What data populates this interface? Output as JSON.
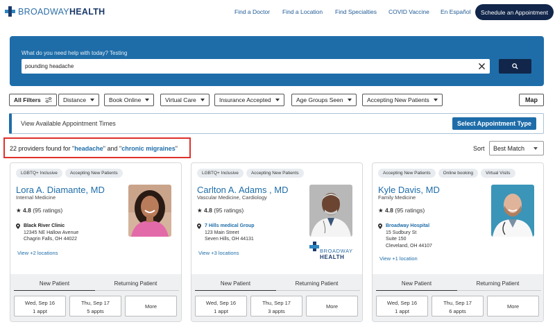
{
  "header": {
    "logo_light": "BROADWAY",
    "logo_bold": "HEALTH",
    "nav": [
      "Find a Doctor",
      "Find a Location",
      "Find Specialties",
      "COVID Vaccine",
      "En Español"
    ],
    "cta": "Schedule an Appointment"
  },
  "search": {
    "label": "What do you need help with today? Testing",
    "value": "pounding headache"
  },
  "filters": {
    "all": "All Filters",
    "items": [
      "Distance",
      "Book Online",
      "Virtual Care",
      "Insurance Accepted",
      "Age Groups Seen",
      "Accepting New Patients"
    ],
    "map": "Map"
  },
  "appointment_bar": {
    "text": "View Available Appointment Times",
    "button": "Select Appointment Type"
  },
  "results": {
    "prefix": "22 providers found for \"",
    "kw1": "headache",
    "mid": "\" and \"",
    "kw2": "chronic migraines",
    "suffix": "\""
  },
  "sort": {
    "label": "Sort",
    "value": "Best Match"
  },
  "tabs": {
    "new": "New Patient",
    "returning": "Returning Patient"
  },
  "more_label": "More",
  "card_logo": {
    "light": "BROADWAY",
    "bold": "HEALTH"
  },
  "providers": [
    {
      "badges": [
        "LGBTQ+ Inclusive",
        "Accepting New Patients"
      ],
      "name": "Lora A. Diamante, MD",
      "specialty": "Internal Medicine",
      "rating": "4.8",
      "ratings_count": "(95 ratings)",
      "location_name": "Black River Clinic",
      "address": [
        "12345 NE Hallow Avenue",
        "Chagrin Falls, OH 44022"
      ],
      "view_locations": "View +2 locations",
      "slots": [
        {
          "date": "Wed, Sep 16",
          "count": "1 appt"
        },
        {
          "date": "Thu, Sep 17",
          "count": "5 appts"
        }
      ]
    },
    {
      "badges": [
        "LGBTQ+ Inclusive",
        "Accepting New Patients"
      ],
      "name": "Carlton A. Adams , MD",
      "specialty": "Vascular Medicine, Cardiology",
      "rating": "4.8",
      "ratings_count": "(95 ratings)",
      "location_name": "7 Hills medical Group",
      "address": [
        "123 Main Street",
        "Seven Hills, OH 44131"
      ],
      "view_locations": "View +3 locations",
      "slots": [
        {
          "date": "Wed, Sep 16",
          "count": "1 appt"
        },
        {
          "date": "Thu, Sep 17",
          "count": "3 appts"
        }
      ]
    },
    {
      "badges": [
        "Accepting New Patients",
        "Online booking",
        "Virtual Visits"
      ],
      "name": "Kyle Davis, MD",
      "specialty": "Family Medicine",
      "rating": "4.8",
      "ratings_count": "(95 ratings)",
      "location_name": "Broadway Hospital",
      "address": [
        "15 Sudbury St",
        "Suite 150",
        "Cleveland, OH 44107"
      ],
      "view_locations": "View +1 location",
      "slots": [
        {
          "date": "Wed, Sep 16",
          "count": "1 appt"
        },
        {
          "date": "Thu, Sep 17",
          "count": "6 appts"
        }
      ]
    }
  ]
}
